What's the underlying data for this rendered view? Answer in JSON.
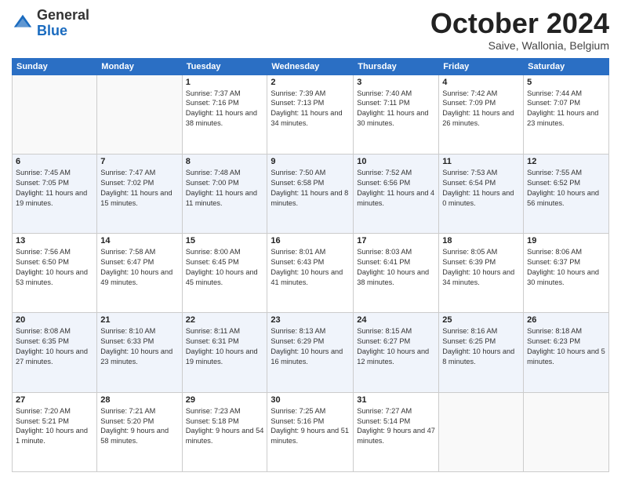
{
  "header": {
    "logo": {
      "general": "General",
      "blue": "Blue"
    },
    "title": "October 2024",
    "subtitle": "Saive, Wallonia, Belgium"
  },
  "weekdays": [
    "Sunday",
    "Monday",
    "Tuesday",
    "Wednesday",
    "Thursday",
    "Friday",
    "Saturday"
  ],
  "weeks": [
    [
      {
        "day": "",
        "info": ""
      },
      {
        "day": "",
        "info": ""
      },
      {
        "day": "1",
        "info": "Sunrise: 7:37 AM\nSunset: 7:16 PM\nDaylight: 11 hours and 38 minutes."
      },
      {
        "day": "2",
        "info": "Sunrise: 7:39 AM\nSunset: 7:13 PM\nDaylight: 11 hours and 34 minutes."
      },
      {
        "day": "3",
        "info": "Sunrise: 7:40 AM\nSunset: 7:11 PM\nDaylight: 11 hours and 30 minutes."
      },
      {
        "day": "4",
        "info": "Sunrise: 7:42 AM\nSunset: 7:09 PM\nDaylight: 11 hours and 26 minutes."
      },
      {
        "day": "5",
        "info": "Sunrise: 7:44 AM\nSunset: 7:07 PM\nDaylight: 11 hours and 23 minutes."
      }
    ],
    [
      {
        "day": "6",
        "info": "Sunrise: 7:45 AM\nSunset: 7:05 PM\nDaylight: 11 hours and 19 minutes."
      },
      {
        "day": "7",
        "info": "Sunrise: 7:47 AM\nSunset: 7:02 PM\nDaylight: 11 hours and 15 minutes."
      },
      {
        "day": "8",
        "info": "Sunrise: 7:48 AM\nSunset: 7:00 PM\nDaylight: 11 hours and 11 minutes."
      },
      {
        "day": "9",
        "info": "Sunrise: 7:50 AM\nSunset: 6:58 PM\nDaylight: 11 hours and 8 minutes."
      },
      {
        "day": "10",
        "info": "Sunrise: 7:52 AM\nSunset: 6:56 PM\nDaylight: 11 hours and 4 minutes."
      },
      {
        "day": "11",
        "info": "Sunrise: 7:53 AM\nSunset: 6:54 PM\nDaylight: 11 hours and 0 minutes."
      },
      {
        "day": "12",
        "info": "Sunrise: 7:55 AM\nSunset: 6:52 PM\nDaylight: 10 hours and 56 minutes."
      }
    ],
    [
      {
        "day": "13",
        "info": "Sunrise: 7:56 AM\nSunset: 6:50 PM\nDaylight: 10 hours and 53 minutes."
      },
      {
        "day": "14",
        "info": "Sunrise: 7:58 AM\nSunset: 6:47 PM\nDaylight: 10 hours and 49 minutes."
      },
      {
        "day": "15",
        "info": "Sunrise: 8:00 AM\nSunset: 6:45 PM\nDaylight: 10 hours and 45 minutes."
      },
      {
        "day": "16",
        "info": "Sunrise: 8:01 AM\nSunset: 6:43 PM\nDaylight: 10 hours and 41 minutes."
      },
      {
        "day": "17",
        "info": "Sunrise: 8:03 AM\nSunset: 6:41 PM\nDaylight: 10 hours and 38 minutes."
      },
      {
        "day": "18",
        "info": "Sunrise: 8:05 AM\nSunset: 6:39 PM\nDaylight: 10 hours and 34 minutes."
      },
      {
        "day": "19",
        "info": "Sunrise: 8:06 AM\nSunset: 6:37 PM\nDaylight: 10 hours and 30 minutes."
      }
    ],
    [
      {
        "day": "20",
        "info": "Sunrise: 8:08 AM\nSunset: 6:35 PM\nDaylight: 10 hours and 27 minutes."
      },
      {
        "day": "21",
        "info": "Sunrise: 8:10 AM\nSunset: 6:33 PM\nDaylight: 10 hours and 23 minutes."
      },
      {
        "day": "22",
        "info": "Sunrise: 8:11 AM\nSunset: 6:31 PM\nDaylight: 10 hours and 19 minutes."
      },
      {
        "day": "23",
        "info": "Sunrise: 8:13 AM\nSunset: 6:29 PM\nDaylight: 10 hours and 16 minutes."
      },
      {
        "day": "24",
        "info": "Sunrise: 8:15 AM\nSunset: 6:27 PM\nDaylight: 10 hours and 12 minutes."
      },
      {
        "day": "25",
        "info": "Sunrise: 8:16 AM\nSunset: 6:25 PM\nDaylight: 10 hours and 8 minutes."
      },
      {
        "day": "26",
        "info": "Sunrise: 8:18 AM\nSunset: 6:23 PM\nDaylight: 10 hours and 5 minutes."
      }
    ],
    [
      {
        "day": "27",
        "info": "Sunrise: 7:20 AM\nSunset: 5:21 PM\nDaylight: 10 hours and 1 minute."
      },
      {
        "day": "28",
        "info": "Sunrise: 7:21 AM\nSunset: 5:20 PM\nDaylight: 9 hours and 58 minutes."
      },
      {
        "day": "29",
        "info": "Sunrise: 7:23 AM\nSunset: 5:18 PM\nDaylight: 9 hours and 54 minutes."
      },
      {
        "day": "30",
        "info": "Sunrise: 7:25 AM\nSunset: 5:16 PM\nDaylight: 9 hours and 51 minutes."
      },
      {
        "day": "31",
        "info": "Sunrise: 7:27 AM\nSunset: 5:14 PM\nDaylight: 9 hours and 47 minutes."
      },
      {
        "day": "",
        "info": ""
      },
      {
        "day": "",
        "info": ""
      }
    ]
  ]
}
